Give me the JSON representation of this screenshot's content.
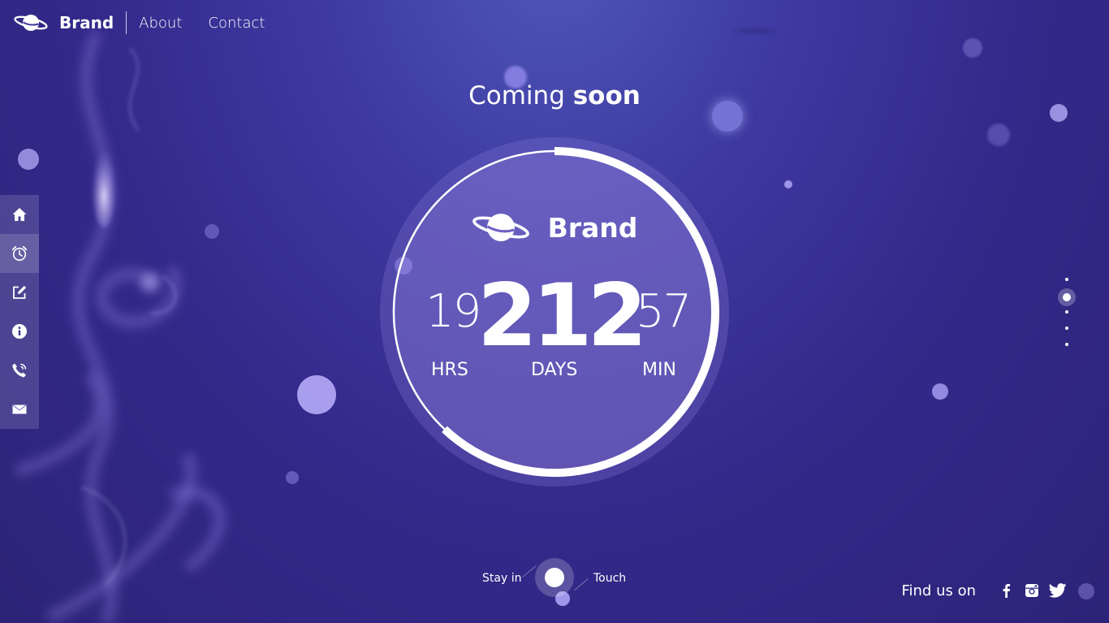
{
  "header": {
    "brand": "Brand",
    "nav": [
      "About",
      "Contact"
    ]
  },
  "title": {
    "light": "Coming",
    "bold": "soon"
  },
  "sidebar": {
    "items": [
      {
        "icon": "home-icon"
      },
      {
        "icon": "alarm-clock-icon",
        "active": true
      },
      {
        "icon": "edit-icon"
      },
      {
        "icon": "info-icon"
      },
      {
        "icon": "phone-icon"
      },
      {
        "icon": "mail-icon"
      }
    ]
  },
  "countdown": {
    "brand": "Brand",
    "hours": "19",
    "days": "212",
    "minutes": "57",
    "hours_label": "HRS",
    "days_label": "DAYS",
    "minutes_label": "MIN",
    "progress": 0.62
  },
  "pager": {
    "count": 5,
    "active_index": 1
  },
  "contact": {
    "left": "Stay in",
    "right": "Touch"
  },
  "social": {
    "label": "Find us on",
    "networks": [
      "facebook-icon",
      "instagram-icon",
      "twitter-icon"
    ]
  },
  "colors": {
    "background_top": "#5058b8",
    "background_bottom": "#2c2478",
    "accent": "#ffffff",
    "orb": "#b5a8f5"
  }
}
